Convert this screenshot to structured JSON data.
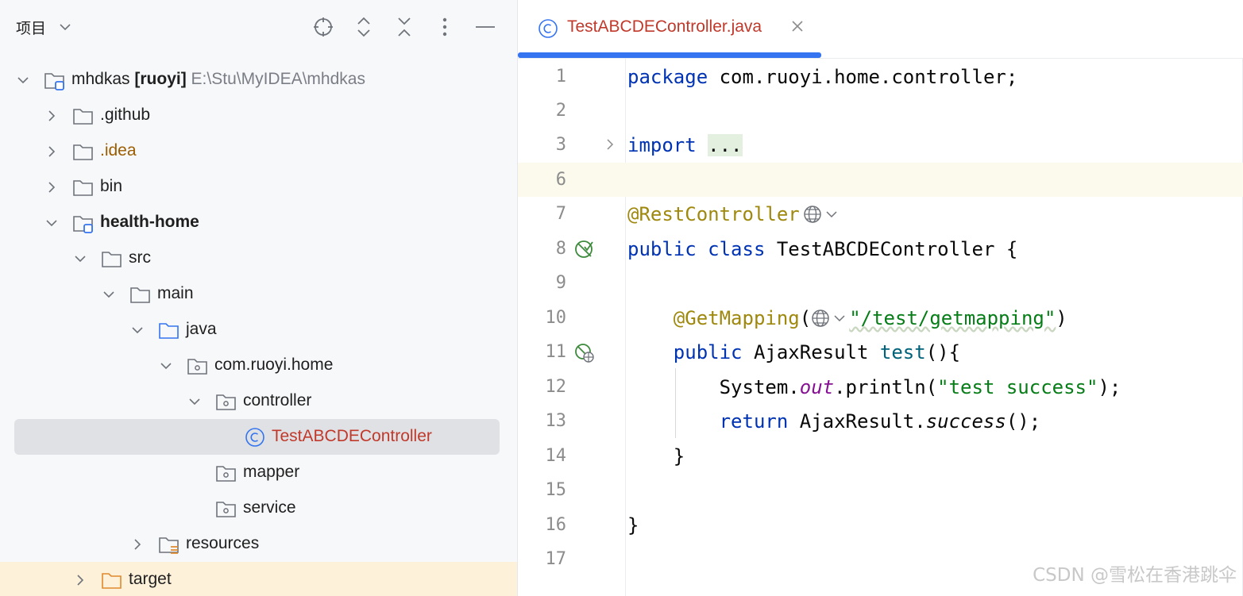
{
  "project_panel": {
    "title": "项目",
    "tree": [
      {
        "label": "mhdkas",
        "suffix": "[ruoyi]",
        "path": "E:\\Stu\\MyIDEA\\mhdkas",
        "expanded": true,
        "icon": "module-folder-icon"
      },
      {
        "label": ".github",
        "expanded": false,
        "icon": "folder-icon"
      },
      {
        "label": ".idea",
        "expanded": false,
        "icon": "folder-icon"
      },
      {
        "label": "bin",
        "expanded": false,
        "icon": "folder-icon"
      },
      {
        "label": "health-home",
        "expanded": true,
        "icon": "module-folder-icon"
      },
      {
        "label": "src",
        "expanded": true,
        "icon": "folder-icon"
      },
      {
        "label": "main",
        "expanded": true,
        "icon": "folder-icon"
      },
      {
        "label": "java",
        "expanded": true,
        "icon": "source-folder-icon"
      },
      {
        "label": "com.ruoyi.home",
        "expanded": true,
        "icon": "package-icon"
      },
      {
        "label": "controller",
        "expanded": true,
        "icon": "package-icon"
      },
      {
        "label": "TestABCDEController",
        "selected": true,
        "icon": "class-icon"
      },
      {
        "label": "mapper",
        "icon": "package-icon"
      },
      {
        "label": "service",
        "icon": "package-icon"
      },
      {
        "label": "resources",
        "expanded": false,
        "icon": "resources-folder-icon"
      },
      {
        "label": "target",
        "expanded": false,
        "icon": "excluded-folder-icon"
      }
    ]
  },
  "editor": {
    "tab": {
      "label": "TestABCDEController.java",
      "icon": "class-icon"
    },
    "line_numbers": [
      "1",
      "2",
      "3",
      "6",
      "7",
      "8",
      "9",
      "10",
      "11",
      "12",
      "13",
      "14",
      "15",
      "16",
      "17"
    ],
    "code": {
      "l1_kw": "package",
      "l1_rest": " com.ruoyi.home.controller;",
      "l3_kw": "import",
      "l3_fold": "...",
      "l7_ann": "@RestController",
      "l8_kw1": "public",
      "l8_kw2": "class",
      "l8_rest": " TestABCDEController {",
      "l10_ann": "@GetMapping",
      "l10_open": "(",
      "l10_str": "\"/test/getmapping\"",
      "l10_close": ")",
      "l11_kw": "public",
      "l11_type": " AjaxResult ",
      "l11_method": "test",
      "l11_rest": "(){",
      "l12_obj": "System.",
      "l12_field": "out",
      "l12_call": ".println(",
      "l12_str": "\"test success\"",
      "l12_end": ");",
      "l13_kw": "return",
      "l13_type": " AjaxResult.",
      "l13_method": "success",
      "l13_end": "();",
      "l14": "}",
      "l16": "}"
    }
  },
  "watermark": "CSDN @雪松在香港跳伞",
  "colors": {
    "accent": "#3574f0",
    "keyword": "#0033b3",
    "annotation": "#9e880d",
    "string": "#067d17",
    "selection": "#dfe1e5"
  }
}
